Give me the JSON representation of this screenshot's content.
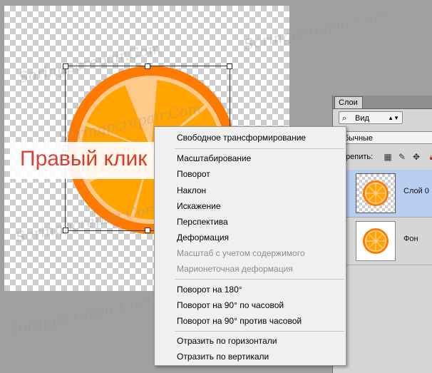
{
  "callout": {
    "text": "Правый клик"
  },
  "watermark": {
    "text": "Soringpcrepair.Com"
  },
  "layers_panel": {
    "tab_label": "Слои",
    "kind_filter": "Вид",
    "blend_mode": "бычные",
    "lock_label": "репить:",
    "layers": [
      {
        "name": "Слой 0",
        "selected": true
      },
      {
        "name": "Фон",
        "selected": false
      }
    ]
  },
  "context_menu": {
    "items": [
      {
        "label": "Свободное трансформирование",
        "enabled": true
      },
      {
        "label": "Масштабирование",
        "enabled": true
      },
      {
        "label": "Поворот",
        "enabled": true
      },
      {
        "label": "Наклон",
        "enabled": true
      },
      {
        "label": "Искажение",
        "enabled": true
      },
      {
        "label": "Перспектива",
        "enabled": true
      },
      {
        "label": "Деформация",
        "enabled": true
      },
      {
        "label": "Масштаб с учетом содержимого",
        "enabled": false
      },
      {
        "label": "Марионеточная деформация",
        "enabled": false
      },
      {
        "label": "Поворот на 180°",
        "enabled": true
      },
      {
        "label": "Поворот на 90° по часовой",
        "enabled": true
      },
      {
        "label": "Поворот на 90° против часовой",
        "enabled": true
      },
      {
        "label": "Отразить по горизонтали",
        "enabled": true
      },
      {
        "label": "Отразить по вертикали",
        "enabled": true
      }
    ]
  },
  "colors": {
    "orange_rind": "#ff7a00",
    "orange_pith": "#ffc98a",
    "orange_flesh": "#ffa400",
    "callout_text": "#d9342b",
    "selected_layer": "#b9cdf0"
  }
}
